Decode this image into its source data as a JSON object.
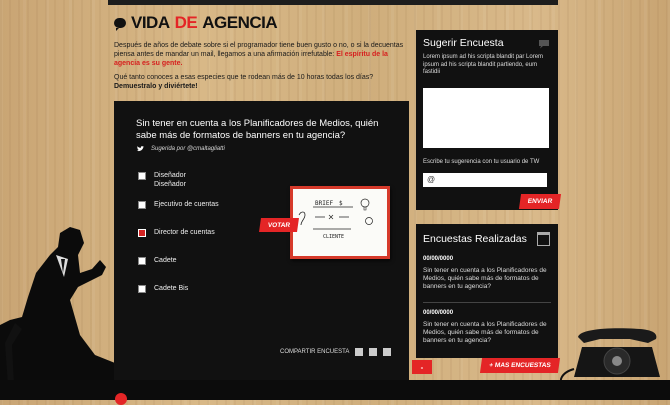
{
  "logo": {
    "part1": "VIDA",
    "part2": "DE",
    "part3": "AGENCIA"
  },
  "intro": {
    "text": "Después de años de debate sobre si el programador tiene buen gusto o no, o si la decuentas piensa antes de mandar un mail, llegamos a una afirmación irrefutable: ",
    "highlight": "El espíritu de la agencia es su gente.",
    "question": "Qué tanto conoces a esas especies que te rodean más de 10 horas todas los días?",
    "cta": "Demuestralo y diviértete!"
  },
  "poll": {
    "question": "Sin tener en cuenta a los Planificadores de Medios, quién sabe más de formatos de banners en tu agencia?",
    "suggested_by": "Sugerida por @cmaltagliatti",
    "options": [
      {
        "label": "Diseñador Diseñador",
        "selected": false
      },
      {
        "label": "Ejecutivo de cuentas",
        "selected": false
      },
      {
        "label": "Director de cuentas",
        "selected": true
      },
      {
        "label": "Cadete",
        "selected": false
      },
      {
        "label": "Cadete Bis",
        "selected": false
      }
    ],
    "vote_label": "VOTAR",
    "share_label": "COMPARTIR ENCUESTA"
  },
  "whiteboard": {
    "line1": "BRIEF",
    "line2": "$",
    "line3": "CLIENTE"
  },
  "suggest": {
    "title": "Sugerir Encuesta",
    "description": "Lorem ipsum ad his scripta blandit par Lorem ipsum ad his scripta blandit partiendo, eum fastidii",
    "twitter_label": "Escribe tu sugerencia con tu usuario de TW",
    "twitter_value": "@",
    "send_label": "ENVIAR"
  },
  "completed": {
    "title": "Encuestas Realizadas",
    "items": [
      {
        "date": "00/00/0000",
        "text": "Sin tener en cuenta a los Planificadores de Medios, quién sabe más de formatos de banners en tu agencia?"
      },
      {
        "date": "00/00/0000",
        "text": "Sin tener en cuenta a los Planificadores de Medios, quién sabe más de formatos de banners en tu agencia?"
      }
    ],
    "prev_label": "-",
    "more_label": "+ MAS ENCUESTAS"
  },
  "colors": {
    "accent": "#e42526",
    "panel": "#111111"
  }
}
